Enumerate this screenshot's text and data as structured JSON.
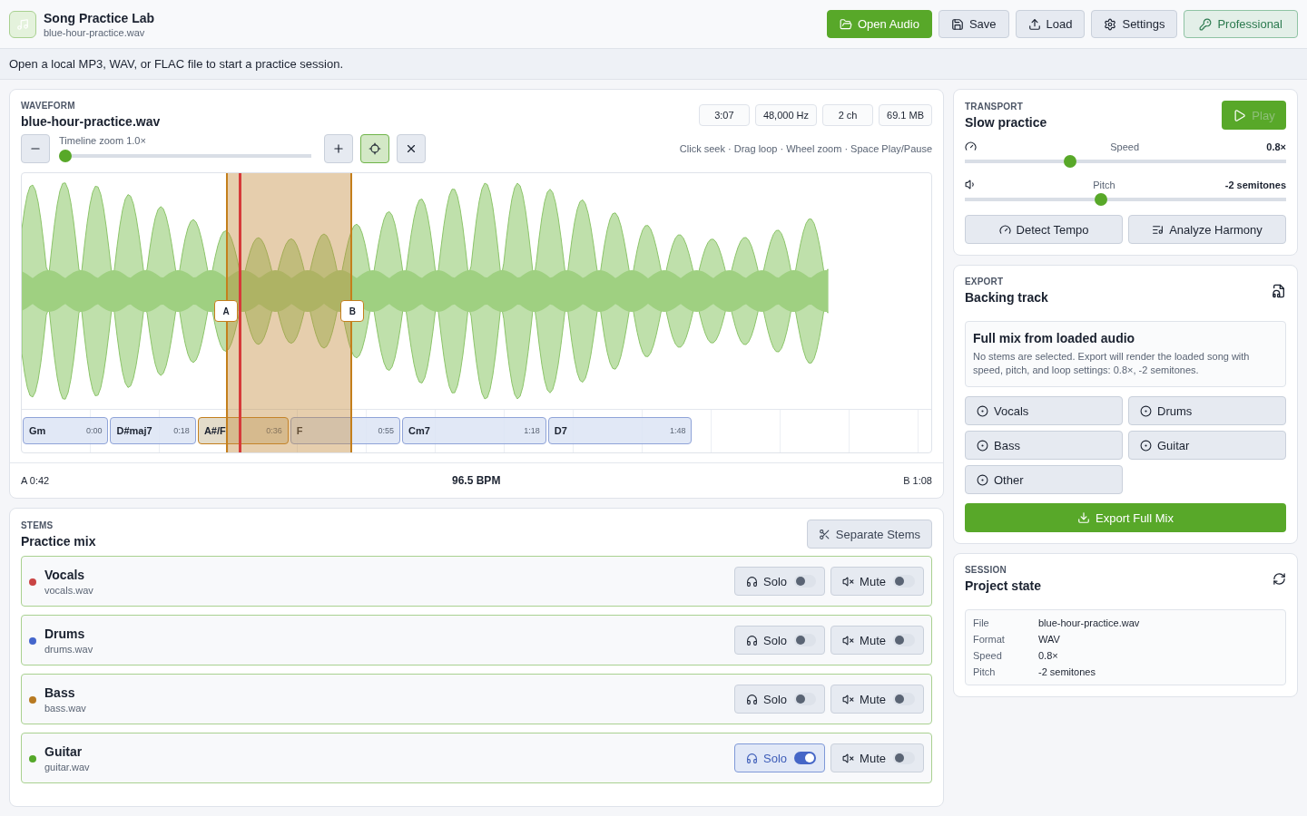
{
  "app": {
    "title": "Song Practice Lab",
    "subtitle": "blue-hour-practice.wav"
  },
  "toolbar": [
    {
      "label": "Open Audio",
      "kind": "primary"
    },
    {
      "label": "Save",
      "kind": "plain"
    },
    {
      "label": "Load",
      "kind": "plain"
    },
    {
      "label": "Settings",
      "kind": "plain"
    },
    {
      "label": "Professional",
      "kind": "license"
    }
  ],
  "notice": "Open a local MP3, WAV, or FLAC file to start a practice session.",
  "waveform": {
    "eyebrow": "WAVEFORM",
    "title": "blue-hour-practice.wav",
    "stats": [
      "3:07",
      "48,000 Hz",
      "2 ch",
      "69.1 MB"
    ],
    "zoom": {
      "label": "Timeline zoom 1.0×",
      "level": 0.0
    },
    "follow_playhead": {
      "selected": true
    },
    "hint": "Click seek · Drag loop · Wheel zoom · Space Play/Pause",
    "loop": {
      "start_marker": "A",
      "end_marker": "B",
      "start": "A 0:42",
      "end": "B 1:08"
    },
    "playhead": {
      "level": 0.24
    },
    "chords": [
      {
        "name": "Gm",
        "time": "0:00",
        "selected": false
      },
      {
        "name": "D#maj7",
        "time": "0:18",
        "selected": false
      },
      {
        "name": "A#/F",
        "time": "0:36",
        "selected": true
      },
      {
        "name": "F",
        "time": "0:55",
        "selected": false
      },
      {
        "name": "Cm7",
        "time": "1:18",
        "selected": false
      },
      {
        "name": "D7",
        "time": "1:48",
        "selected": false
      }
    ],
    "bpm": "96.5 BPM"
  },
  "stems": {
    "eyebrow": "STEMS",
    "title": "Practice mix",
    "action": "Separate Stems",
    "items": [
      {
        "name": "Vocals",
        "file": "vocals.wav",
        "color": "#c94444",
        "solo": false,
        "mute": false,
        "solo_label": "Solo",
        "mute_label": "Mute"
      },
      {
        "name": "Drums",
        "file": "drums.wav",
        "color": "#4466cc",
        "solo": false,
        "mute": false,
        "solo_label": "Solo",
        "mute_label": "Mute"
      },
      {
        "name": "Bass",
        "file": "bass.wav",
        "color": "#b87a22",
        "solo": false,
        "mute": false,
        "solo_label": "Solo",
        "mute_label": "Mute"
      },
      {
        "name": "Guitar",
        "file": "guitar.wav",
        "color": "#55a82a",
        "solo": true,
        "mute": false,
        "solo_label": "Solo",
        "mute_label": "Mute"
      }
    ]
  },
  "transport": {
    "eyebrow": "TRANSPORT",
    "title": "Slow practice",
    "play": "Play",
    "sliders": [
      {
        "label": "Speed",
        "reading": "0.8×",
        "level": 0.32
      },
      {
        "label": "Pitch",
        "reading": "-2 semitones",
        "level": 0.42
      }
    ],
    "buttons": [
      "Detect Tempo",
      "Analyze Harmony"
    ]
  },
  "export": {
    "eyebrow": "EXPORT",
    "title": "Backing track",
    "summary_title": "Full mix from loaded audio",
    "summary": "No stems are selected. Export will render the loaded song with speed, pitch, and loop settings: 0.8×, -2 semitones.",
    "stems": [
      {
        "label": "Vocals",
        "selected": false
      },
      {
        "label": "Drums",
        "selected": false
      },
      {
        "label": "Bass",
        "selected": false
      },
      {
        "label": "Guitar",
        "selected": false
      },
      {
        "label": "Other",
        "selected": false
      }
    ],
    "action": "Export Full Mix"
  },
  "session": {
    "eyebrow": "SESSION",
    "title": "Project state",
    "rows": [
      {
        "key": "File",
        "value": "blue-hour-practice.wav"
      },
      {
        "key": "Format",
        "value": "WAV"
      },
      {
        "key": "Speed",
        "value": "0.8×"
      },
      {
        "key": "Pitch",
        "value": "-2 semitones"
      }
    ]
  }
}
